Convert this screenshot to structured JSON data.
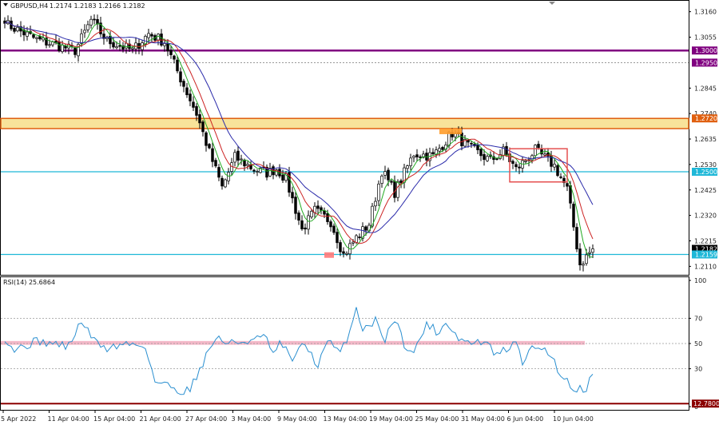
{
  "header": {
    "symbol": "GBPUSD,H4",
    "ohlc": "1.2174 1.2183 1.2166 1.2182"
  },
  "indicator_header": {
    "label": "RSI(14) 25.6864"
  },
  "colors": {
    "bull_candle": "#ffffff",
    "bear_candle": "#000000",
    "ma_fast": "#22aa22",
    "ma_mid": "#cc2222",
    "ma_slow": "#2a2aaa",
    "rsi_line": "#2a8fd0",
    "line_1_3000": "#800080",
    "line_1_2500": "#1fb8d8",
    "line_1_2159": "#1fb8d8",
    "zone_fill": "#f8e39a",
    "zone_border": "#e06010",
    "rsi_band": "#f4b8c8",
    "line_12_7800": "#8b0000",
    "rect_box": "#e55050",
    "box_high": "#ff9c2a",
    "box_low": "#ff7a7a"
  },
  "chart_data": [
    {
      "type": "candlestick",
      "title": "GBPUSD,H4",
      "x_ticks": [
        "5 Apr 2022",
        "11 Apr 04:00",
        "15 Apr 04:00",
        "21 Apr 04:00",
        "27 Apr 04:00",
        "3 May 04:00",
        "9 May 04:00",
        "13 May 04:00",
        "19 May 04:00",
        "25 May 04:00",
        "31 May 04:00",
        "6 Jun 04:00",
        "10 Jun 04:00"
      ],
      "y_ticks": [
        1.316,
        1.3055,
        1.2845,
        1.274,
        1.2635,
        1.253,
        1.2425,
        1.232,
        1.2215,
        1.211
      ],
      "ylim": [
        1.2075,
        1.3205
      ],
      "n_bars": 185,
      "anchors": [
        [
          0,
          1.3112
        ],
        [
          10,
          1.3045
        ],
        [
          22,
          1.3
        ],
        [
          27,
          1.3125
        ],
        [
          32,
          1.304
        ],
        [
          40,
          1.3
        ],
        [
          45,
          1.307
        ],
        [
          50,
          1.3035
        ],
        [
          55,
          1.2885
        ],
        [
          60,
          1.274
        ],
        [
          64,
          1.258
        ],
        [
          68,
          1.2435
        ],
        [
          72,
          1.256
        ],
        [
          78,
          1.251
        ],
        [
          82,
          1.2495
        ],
        [
          85,
          1.2512
        ],
        [
          88,
          1.247
        ],
        [
          93,
          1.226
        ],
        [
          97,
          1.234
        ],
        [
          102,
          1.2295
        ],
        [
          106,
          1.2158
        ],
        [
          110,
          1.2228
        ],
        [
          114,
          1.2285
        ],
        [
          118,
          1.2505
        ],
        [
          122,
          1.2415
        ],
        [
          128,
          1.2575
        ],
        [
          134,
          1.2565
        ],
        [
          140,
          1.266
        ],
        [
          146,
          1.2595
        ],
        [
          152,
          1.2545
        ],
        [
          156,
          1.2585
        ],
        [
          160,
          1.251
        ],
        [
          166,
          1.2588
        ],
        [
          172,
          1.2525
        ],
        [
          176,
          1.2428
        ],
        [
          180,
          1.2118
        ],
        [
          184,
          1.2182
        ]
      ],
      "price_labels": [
        {
          "value": 1.3,
          "label": "1.3000",
          "color_key": "line_1_3000",
          "style": "line"
        },
        {
          "value": 1.295,
          "label": "1.2950",
          "color_key": "line_1_3000",
          "style": "dotted"
        },
        {
          "value": 1.272,
          "label": "1.2720",
          "color_key": "zone_border",
          "style": "line"
        },
        {
          "value": 1.25,
          "label": "1.2500",
          "color_key": "line_1_2500",
          "style": "line"
        },
        {
          "value": 1.2182,
          "label": "1.2182",
          "color_key": "bear_candle",
          "style": "current"
        },
        {
          "value": 1.2159,
          "label": "1.2159",
          "color_key": "line_1_2159",
          "style": "line"
        }
      ],
      "zone": {
        "from": 1.2678,
        "to": 1.272
      },
      "rect_box": {
        "x_from": 158,
        "x_to": 176,
        "top": 1.2595,
        "bottom": 1.2458
      },
      "marker_high": {
        "x_from": 136,
        "x_to": 143,
        "top": 1.2678,
        "bottom": 1.2655
      },
      "marker_low": {
        "x_from": 100,
        "x_to": 103,
        "top": 1.2168,
        "bottom": 1.2145
      }
    },
    {
      "type": "line",
      "title": "RSI(14) 25.6864",
      "y_ticks": [
        100,
        70,
        50,
        30,
        0
      ],
      "ylim": [
        0,
        100
      ],
      "last_value": 25.6864,
      "anchors": [
        [
          0,
          55
        ],
        [
          3,
          45
        ],
        [
          6,
          48
        ],
        [
          10,
          52
        ],
        [
          15,
          50
        ],
        [
          20,
          48
        ],
        [
          24,
          68
        ],
        [
          28,
          52
        ],
        [
          32,
          46
        ],
        [
          38,
          50
        ],
        [
          44,
          48
        ],
        [
          47,
          20
        ],
        [
          52,
          16
        ],
        [
          55,
          12
        ],
        [
          58,
          14
        ],
        [
          62,
          35
        ],
        [
          66,
          55
        ],
        [
          70,
          50
        ],
        [
          76,
          52
        ],
        [
          82,
          55
        ],
        [
          84,
          40
        ],
        [
          86,
          50
        ],
        [
          90,
          38
        ],
        [
          94,
          50
        ],
        [
          98,
          32
        ],
        [
          101,
          52
        ],
        [
          105,
          42
        ],
        [
          108,
          60
        ],
        [
          110,
          78
        ],
        [
          112,
          62
        ],
        [
          116,
          68
        ],
        [
          119,
          54
        ],
        [
          122,
          70
        ],
        [
          125,
          50
        ],
        [
          128,
          42
        ],
        [
          132,
          66
        ],
        [
          136,
          58
        ],
        [
          138,
          68
        ],
        [
          142,
          54
        ],
        [
          146,
          50
        ],
        [
          150,
          52
        ],
        [
          154,
          40
        ],
        [
          156,
          44
        ],
        [
          160,
          50
        ],
        [
          162,
          36
        ],
        [
          166,
          48
        ],
        [
          170,
          44
        ],
        [
          174,
          26
        ],
        [
          178,
          14
        ],
        [
          182,
          15
        ],
        [
          184,
          25.7
        ]
      ],
      "band": {
        "from": 49,
        "to": 52
      },
      "levels": [
        {
          "value": 70,
          "style": "dotted"
        },
        {
          "value": 50,
          "style": "dotted"
        },
        {
          "value": 30,
          "style": "dotted"
        },
        {
          "value": 2.4,
          "label": "12.7800",
          "color_key": "line_12_7800",
          "style": "line"
        }
      ]
    }
  ]
}
